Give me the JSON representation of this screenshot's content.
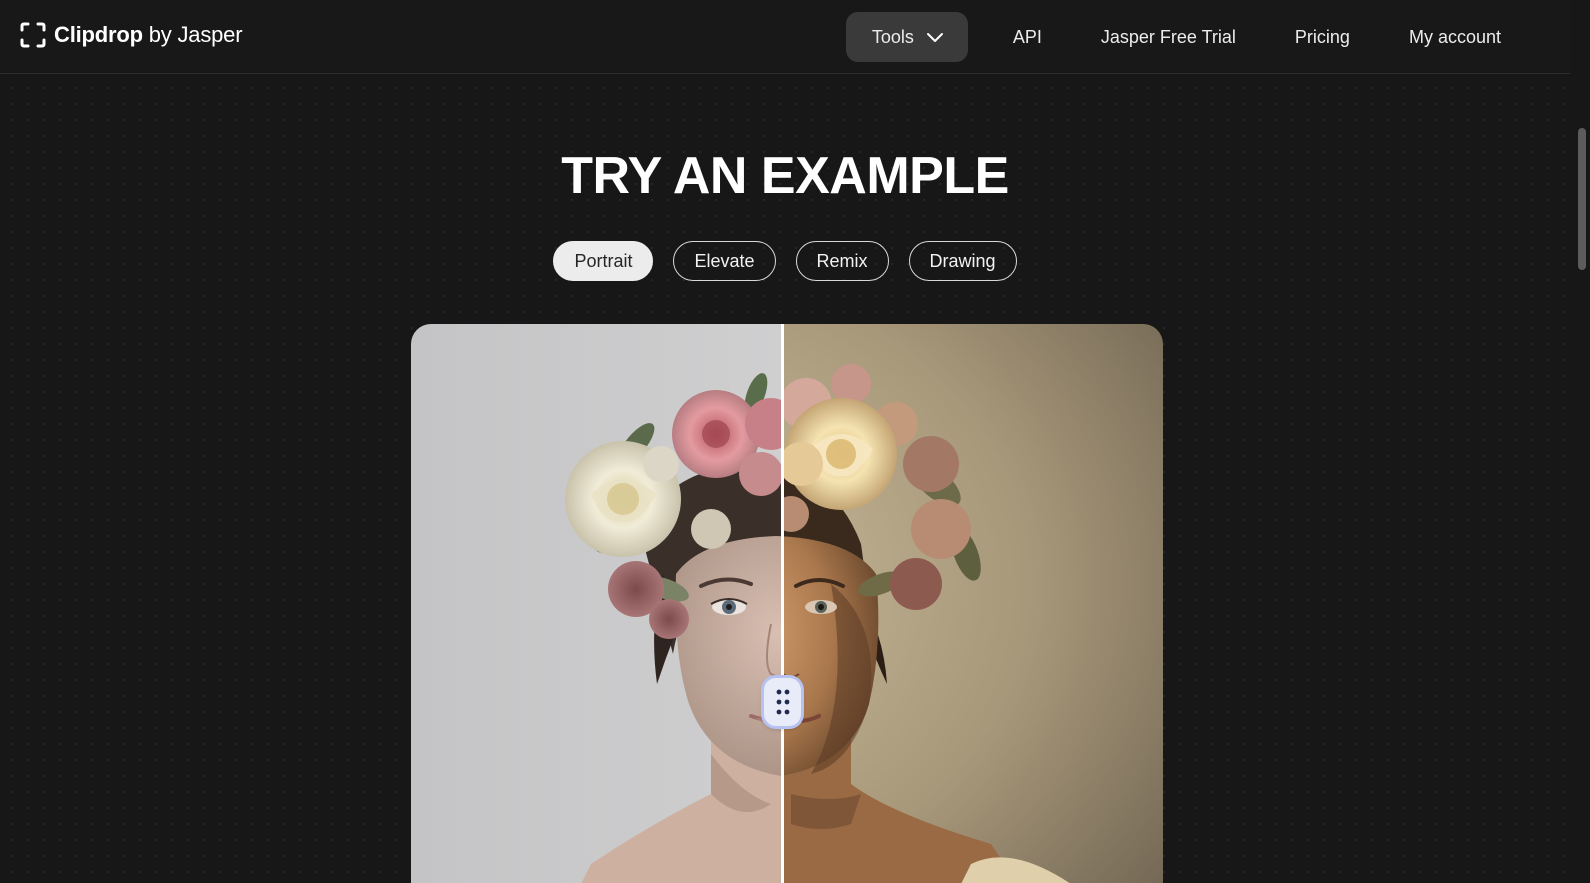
{
  "header": {
    "brand": {
      "name": "Clipdrop",
      "suffix": " by Jasper"
    },
    "nav": {
      "tools_label": "Tools",
      "api_label": "API",
      "trial_label": "Jasper Free Trial",
      "pricing_label": "Pricing",
      "account_label": "My account"
    }
  },
  "hero": {
    "title": "TRY AN EXAMPLE",
    "tabs": [
      {
        "label": "Portrait",
        "active": true
      },
      {
        "label": "Elevate",
        "active": false
      },
      {
        "label": "Remix",
        "active": false
      },
      {
        "label": "Drawing",
        "active": false
      }
    ]
  },
  "compare": {
    "left_state": "original",
    "right_state": "relit",
    "split_fraction": 0.49
  },
  "icons": {
    "logo": "clipdrop-bracket-icon",
    "tools_dropdown": "chevron-down-icon",
    "handle": "drag-dots-icon"
  },
  "colors": {
    "background": "#171717",
    "header": "#181818",
    "tools_button": "#3a3a3a",
    "active_tab": "#ececec",
    "handle": "#e8ecf8"
  }
}
